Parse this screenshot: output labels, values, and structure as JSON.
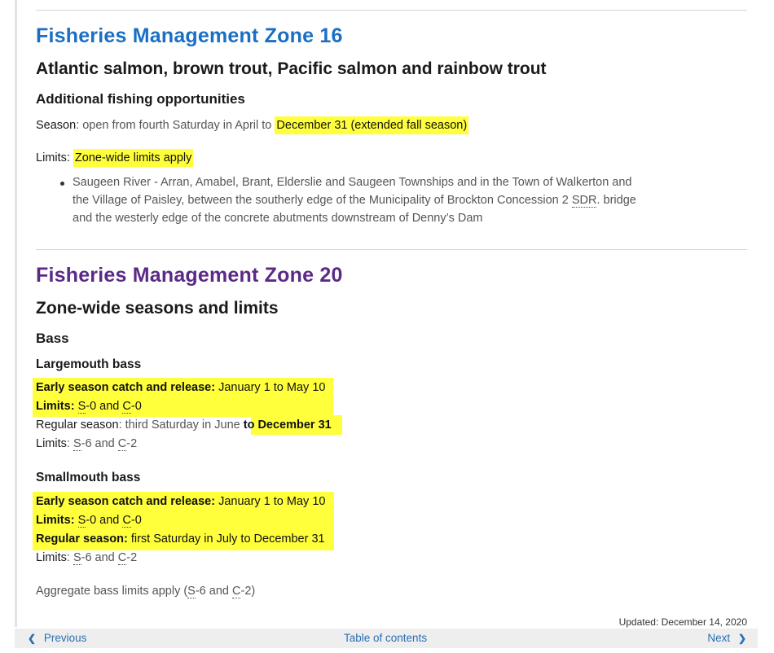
{
  "zone16": {
    "title": "Fisheries Management Zone 16",
    "title_color": "#1a6fc4",
    "species": "Atlantic salmon, brown trout, Pacific salmon and rainbow trout",
    "subheading": "Additional fishing opportunities",
    "season_label": "Season",
    "season_text": ": open from fourth Saturday in April to ",
    "season_highlight": "December 31 (extended fall season)",
    "limits_label": "Limits: ",
    "limits_highlight": "Zone-wide limits apply",
    "bullet_line1": "Saugeen River - Arran, Amabel, Brant, Elderslie and Saugeen Townships and in the Town of Walkerton and",
    "bullet_line2_pre": "the Village of Paisley, between the southerly edge of the Municipality of Brockton Concession 2 ",
    "bullet_abbr": "SDR",
    "bullet_line2_post": ". bridge",
    "bullet_line3": "and the westerly edge of the concrete abutments downstream of Denny’s Dam"
  },
  "zone20": {
    "title": "Fisheries Management Zone 20",
    "title_color": "#5b2a86",
    "subtitle": "Zone-wide seasons and limits",
    "group": "Bass",
    "largemouth": {
      "heading": "Largemouth bass",
      "early_label": "Early season catch and release:",
      "early_value": " January 1 to May 10",
      "limits1_label": "Limits:",
      "limits1_s": "S",
      "limits1_s_val": "-0 and ",
      "limits1_c": "C",
      "limits1_c_val": "-0",
      "regular_label": "Regular season",
      "regular_value": ": third Saturday in June ",
      "regular_highlight": "to December 31",
      "limits2_label": "Limits",
      "limits2_sep": ": ",
      "limits2_s": "S",
      "limits2_s_val": "-6 and ",
      "limits2_c": "C",
      "limits2_c_val": "-2"
    },
    "smallmouth": {
      "heading": "Smallmouth bass",
      "early_label": "Early season catch and release:",
      "early_value": " January 1 to May 10",
      "limits1_label": "Limits:",
      "limits1_s": "S",
      "limits1_s_val": "-0 and ",
      "limits1_c": "C",
      "limits1_c_val": "-0",
      "regular_label": "Regular season:",
      "regular_value": " first Saturday in July to December 31",
      "limits2_label": "Limits",
      "limits2_sep": ": ",
      "limits2_s": "S",
      "limits2_s_val": "-6 and ",
      "limits2_c": "C",
      "limits2_c_val": "-2"
    },
    "aggregate_pre": "Aggregate bass limits apply (",
    "aggregate_s": "S",
    "aggregate_mid": "-6 and ",
    "aggregate_c": "C",
    "aggregate_post": "-2)"
  },
  "footer": {
    "updated": "Updated: December 14, 2020",
    "previous": "Previous",
    "toc": "Table of contents",
    "next": "Next",
    "link_color": "#2a6fb5",
    "highlight_color": "#ffff3c"
  }
}
